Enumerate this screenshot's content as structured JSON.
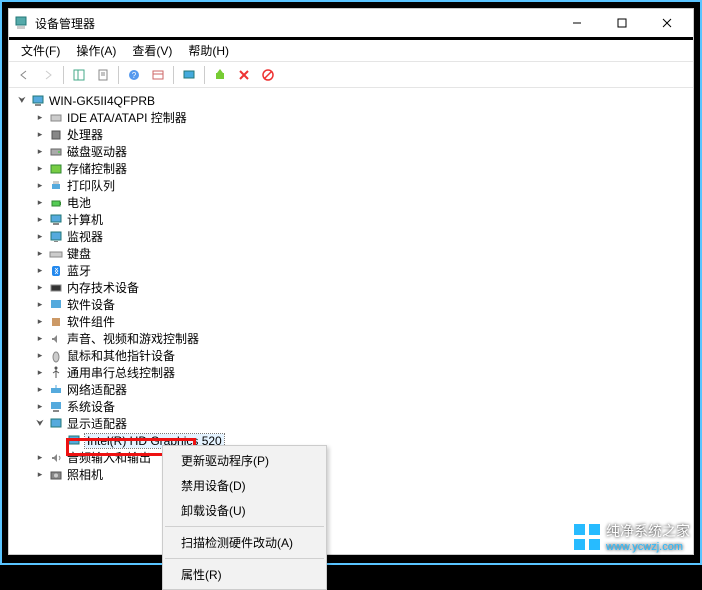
{
  "window": {
    "title": "设备管理器"
  },
  "menu": {
    "file": "文件(F)",
    "action": "操作(A)",
    "view": "查看(V)",
    "help": "帮助(H)"
  },
  "tree": {
    "root": "WIN-GK5II4QFPRB",
    "items": [
      "IDE ATA/ATAPI 控制器",
      "处理器",
      "磁盘驱动器",
      "存储控制器",
      "打印队列",
      "电池",
      "计算机",
      "监视器",
      "键盘",
      "蓝牙",
      "内存技术设备",
      "软件设备",
      "软件组件",
      "声音、视频和游戏控制器",
      "鼠标和其他指针设备",
      "通用串行总线控制器",
      "网络适配器",
      "系统设备",
      "显示适配器",
      "音频输入和输出",
      "照相机"
    ],
    "display_child": "Intel(R) HD Graphics 520"
  },
  "context_menu": {
    "update_driver": "更新驱动程序(P)",
    "disable": "禁用设备(D)",
    "uninstall": "卸载设备(U)",
    "scan": "扫描检测硬件改动(A)",
    "properties": "属性(R)"
  },
  "watermark": {
    "text": "纯净系统之家",
    "url": "www.ycwzj.com"
  }
}
